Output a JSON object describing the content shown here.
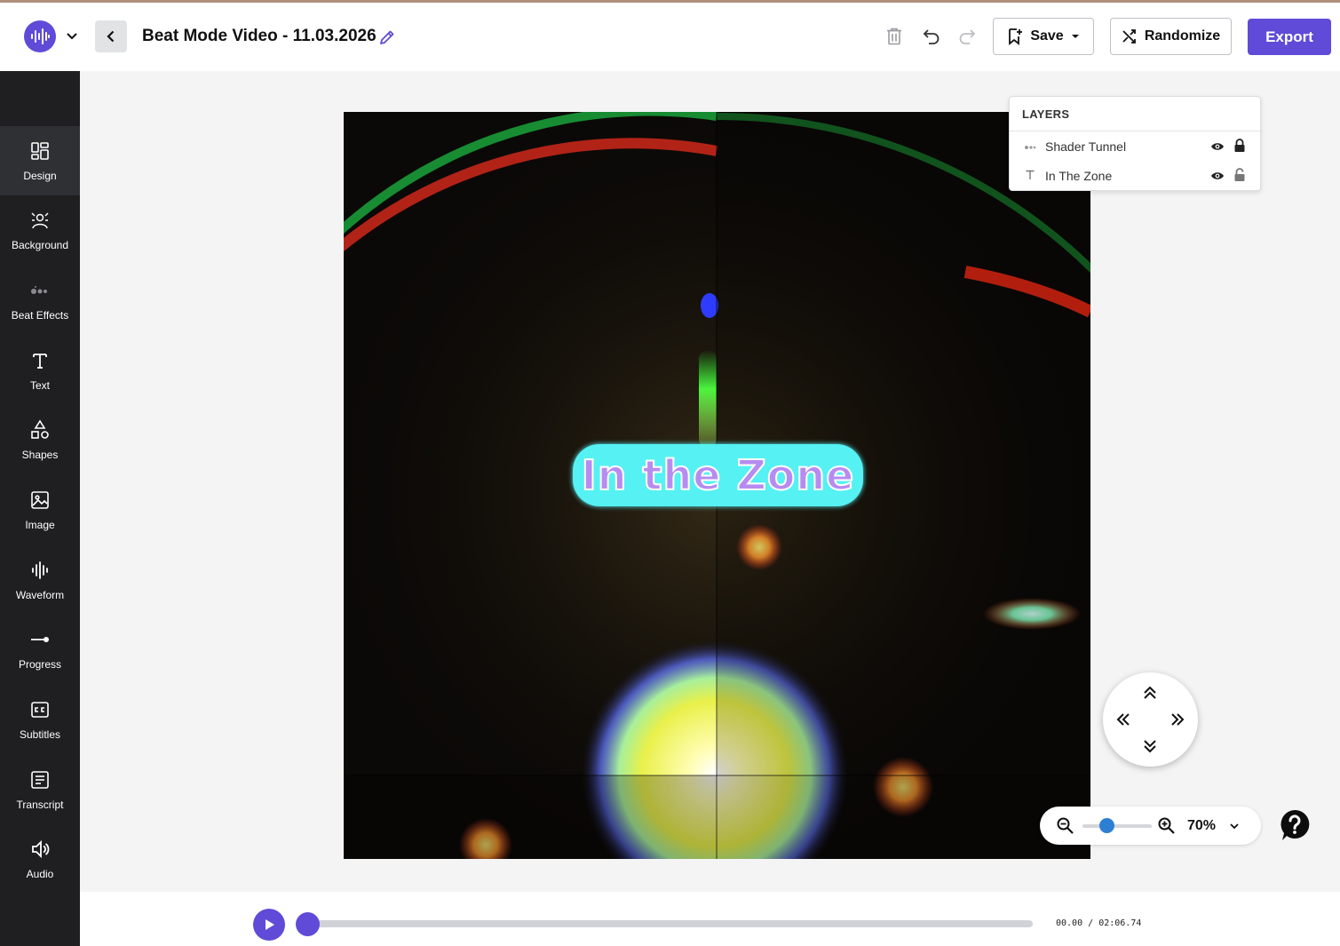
{
  "header": {
    "title": "Beat Mode Video - 11.03.2026",
    "save_label": "Save",
    "randomize_label": "Randomize",
    "export_label": "Export"
  },
  "sidebar": {
    "items": [
      {
        "label": "Design",
        "icon": "design-icon",
        "active": true
      },
      {
        "label": "Background",
        "icon": "background-icon"
      },
      {
        "label": "Beat Effects",
        "icon": "beat-effects-icon"
      },
      {
        "label": "Text",
        "icon": "text-icon"
      },
      {
        "label": "Shapes",
        "icon": "shapes-icon"
      },
      {
        "label": "Image",
        "icon": "image-icon"
      },
      {
        "label": "Waveform",
        "icon": "waveform-icon"
      },
      {
        "label": "Progress",
        "icon": "progress-icon"
      },
      {
        "label": "Subtitles",
        "icon": "subtitles-icon"
      },
      {
        "label": "Transcript",
        "icon": "transcript-icon"
      },
      {
        "label": "Audio",
        "icon": "audio-icon"
      }
    ]
  },
  "canvas": {
    "overlay_text": "In the Zone"
  },
  "layers": {
    "title": "LAYERS",
    "items": [
      {
        "name": "Shader Tunnel",
        "icon": "beat-effects-icon",
        "locked": true
      },
      {
        "name": "In The Zone",
        "icon": "text-icon",
        "locked": false
      }
    ]
  },
  "zoom": {
    "value": "70%",
    "slider_fraction": 0.35
  },
  "playback": {
    "current_time": "00.00",
    "separator": "/",
    "duration": "02:06.74",
    "progress": 0
  },
  "colors": {
    "accent": "#5f4bd8",
    "sidebar_bg": "#1f1f21",
    "text_highlight": "#55f1f3",
    "text_fill": "#b68cf0",
    "zoom_thumb": "#2d7fd3"
  }
}
